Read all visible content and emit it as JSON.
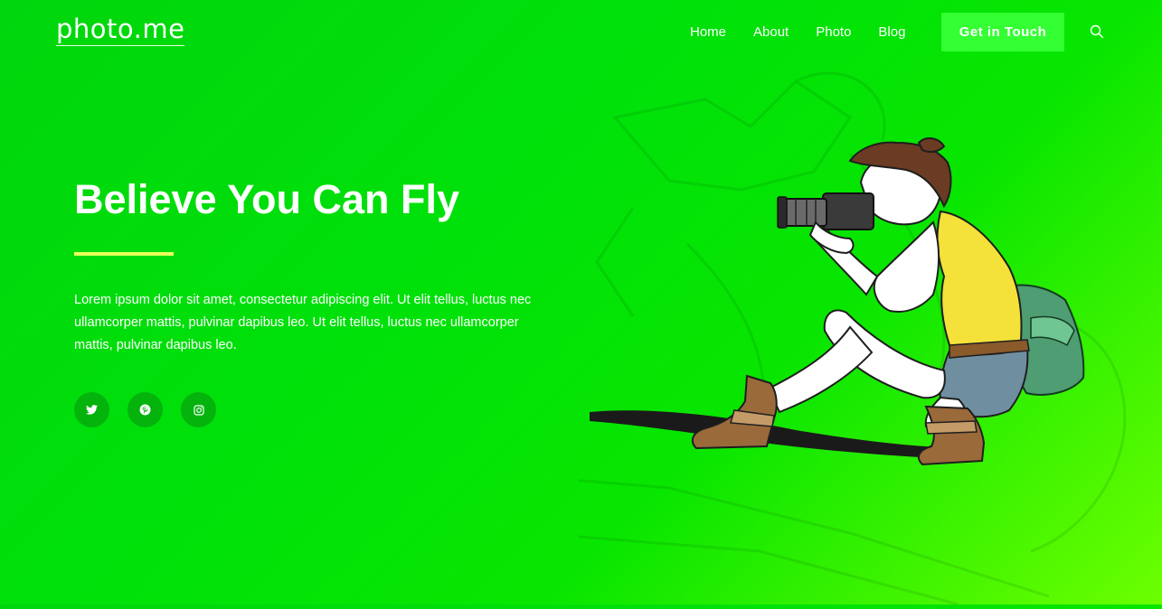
{
  "header": {
    "logo": "photo.me",
    "nav": [
      {
        "label": "Home"
      },
      {
        "label": "About"
      },
      {
        "label": "Photo"
      },
      {
        "label": "Blog"
      }
    ],
    "cta_label": "Get in Touch",
    "search_icon": "search-icon"
  },
  "hero": {
    "title": "Believe You Can Fly",
    "text": "Lorem ipsum dolor sit amet, consectetur adipiscing elit. Ut elit tellus, luctus nec ullamcorper mattis, pulvinar dapibus leo. Ut elit tellus, luctus nec ullamcorper mattis, pulvinar dapibus leo.",
    "socials": [
      {
        "icon": "twitter-icon"
      },
      {
        "icon": "pinterest-icon"
      },
      {
        "icon": "instagram-icon"
      }
    ],
    "illustration": "photographer-illustration"
  },
  "colors": {
    "background": "#00e10a",
    "background_accent": "#6cff00",
    "accent_rule": "#e8ff5a",
    "button": "#33ff33",
    "social_bg": "#05b30d"
  }
}
